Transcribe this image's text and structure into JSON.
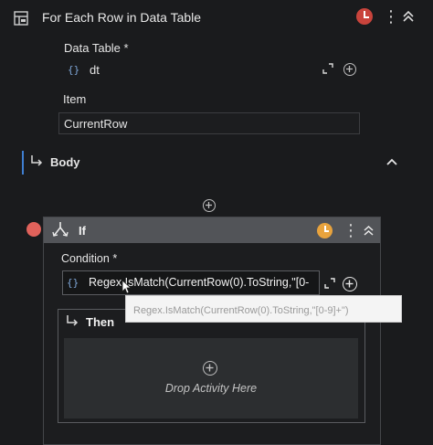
{
  "foreach": {
    "title": "For Each Row in Data Table",
    "data_table_label": "Data Table",
    "data_table_required": "*",
    "data_table_icon": "{}",
    "data_table_value": "dt",
    "item_label": "Item",
    "item_value": "CurrentRow",
    "body_label": "Body"
  },
  "if_activity": {
    "title": "If",
    "condition_label": "Condition",
    "condition_required": "*",
    "condition_icon": "{}",
    "condition_value": "Regex.IsMatch(CurrentRow(0).ToString,\"[0-",
    "tooltip_text": "Regex.IsMatch(CurrentRow(0).ToString,\"[0-9]+\")",
    "then_label": "Then",
    "drop_text": "Drop Activity Here"
  },
  "colors": {
    "background": "#1a1b1d",
    "accent_blue": "#3f7fd1",
    "clock_red": "#c9443c",
    "clock_orange": "#e8a33d",
    "breakpoint_red": "#e0625b",
    "if_header": "#525458"
  },
  "icons": [
    "table-icon",
    "clock-icon",
    "more-vertical-icon",
    "collapse-icon",
    "expand-icon",
    "add-icon",
    "branch-icon",
    "body-arrow-icon",
    "then-arrow-icon"
  ]
}
